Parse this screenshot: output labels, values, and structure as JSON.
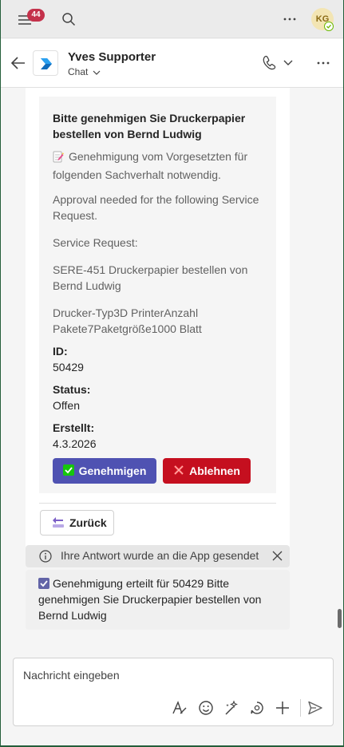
{
  "topbar": {
    "notification_count": "44",
    "avatar_initials": "KG"
  },
  "header": {
    "title": "Yves Supporter",
    "subtitle": "Chat"
  },
  "card": {
    "heading": "Bitte genehmigen Sie Druckerpapier bestellen von Bernd Ludwig",
    "intro_de": "Genehmigung vom Vorgesetzten für folgenden Sachverhalt notwendig.",
    "intro_en": "Approval needed for the following Service Request.",
    "sr_label": "Service Request:",
    "sr_value": "SERE-451 Druckerpapier bestellen von Bernd Ludwig",
    "details": "Drucker-Typ3D PrinterAnzahl Pakete7Paketgröße1000 Blatt",
    "id_label": "ID:",
    "id_value": "50429",
    "status_label": "Status:",
    "status_value": "Offen",
    "created_label": "Erstellt:",
    "created_value": "4.3.2026",
    "approve_label": "Genehmigen",
    "reject_label": "Ablehnen",
    "back_label": "Zurück"
  },
  "notice": {
    "text": "Ihre Antwort wurde an die App gesendet"
  },
  "confirmation": {
    "text": "Genehmigung erteilt für 50429 Bitte genehmigen Sie Druckerpapier bestellen von Bernd Ludwig"
  },
  "composer": {
    "placeholder": "Nachricht eingeben"
  },
  "colors": {
    "approve": "#4f52b2",
    "reject": "#c50f1f",
    "badge": "#c4314b",
    "frame": "#245e3a"
  },
  "icons": [
    "hamburger-icon",
    "search-icon",
    "more-icon",
    "back-arrow-icon",
    "app-logo-icon",
    "phone-icon",
    "chevron-down-icon",
    "memo-icon",
    "check-icon",
    "cross-icon",
    "back-icon",
    "info-icon",
    "close-icon",
    "format-icon",
    "emoji-icon",
    "copilot-icon",
    "loop-icon",
    "plus-icon",
    "send-icon"
  ]
}
